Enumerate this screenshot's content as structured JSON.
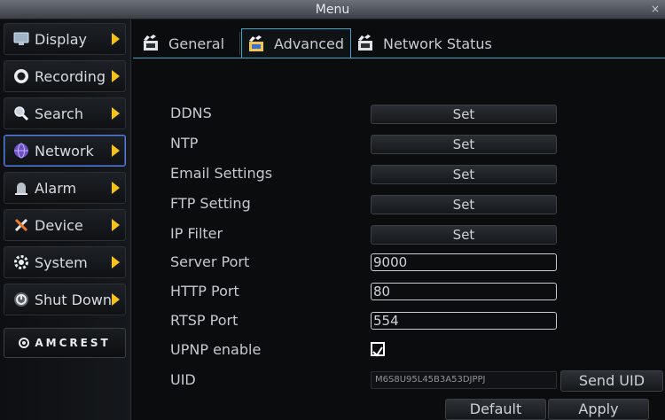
{
  "window": {
    "title": "Menu",
    "close_label": "×"
  },
  "sidebar": {
    "items": [
      {
        "label": "Display",
        "icon": "monitor-icon"
      },
      {
        "label": "Recording",
        "icon": "record-icon"
      },
      {
        "label": "Search",
        "icon": "search-icon"
      },
      {
        "label": "Network",
        "icon": "globe-icon",
        "active": true
      },
      {
        "label": "Alarm",
        "icon": "alarm-icon"
      },
      {
        "label": "Device",
        "icon": "tools-icon"
      },
      {
        "label": "System",
        "icon": "gear-icon"
      },
      {
        "label": "Shut Down",
        "icon": "power-icon"
      }
    ],
    "brand": "AMCREST"
  },
  "tabs": [
    {
      "label": "General",
      "icon": "clapper-icon"
    },
    {
      "label": "Advanced",
      "icon": "clapper-icon",
      "active": true
    },
    {
      "label": "Network Status",
      "icon": "clapper-icon"
    }
  ],
  "settings": {
    "ddns": {
      "label": "DDNS",
      "button": "Set"
    },
    "ntp": {
      "label": "NTP",
      "button": "Set"
    },
    "email": {
      "label": "Email Settings",
      "button": "Set"
    },
    "ftp": {
      "label": "FTP Setting",
      "button": "Set"
    },
    "ipfilter": {
      "label": "IP Filter",
      "button": "Set"
    },
    "server_port": {
      "label": "Server Port",
      "value": "9000"
    },
    "http_port": {
      "label": "HTTP Port",
      "value": "80"
    },
    "rtsp_port": {
      "label": "RTSP Port",
      "value": "554"
    },
    "upnp": {
      "label": "UPNP enable",
      "checked": true
    },
    "uid": {
      "label": "UID",
      "value": "M6S8U95L45B3A53DJPPJ",
      "button": "Send UID"
    }
  },
  "actions": {
    "default": "Default",
    "apply": "Apply"
  },
  "colors": {
    "accent_tab": "#3fa6c9",
    "active_nav_border": "#5a80d8",
    "arrow": "#f4c21a"
  }
}
